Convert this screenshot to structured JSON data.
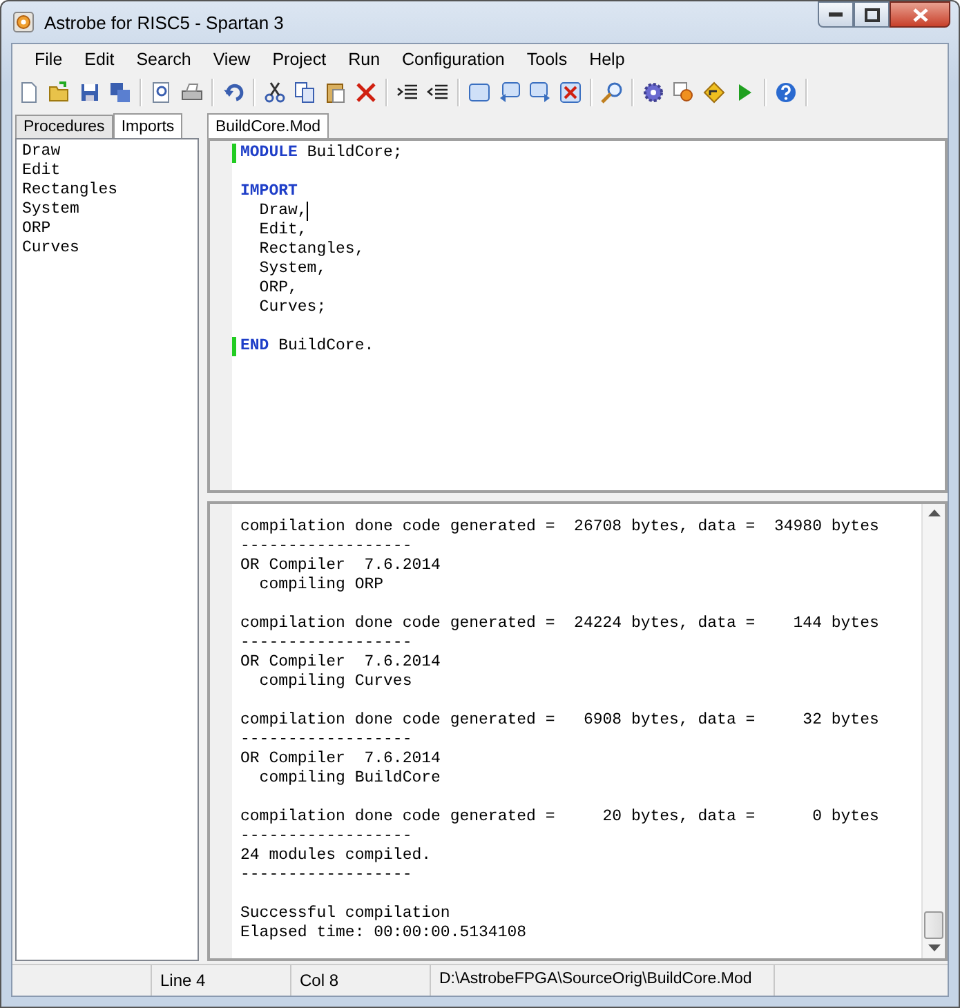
{
  "window": {
    "title": "Astrobe for RISC5  - Spartan 3"
  },
  "menu": [
    "File",
    "Edit",
    "Search",
    "View",
    "Project",
    "Run",
    "Configuration",
    "Tools",
    "Help"
  ],
  "side_tabs": [
    {
      "label": "Procedures",
      "selected": false
    },
    {
      "label": "Imports",
      "selected": true
    }
  ],
  "side_items": [
    "Draw",
    "Edit",
    "Rectangles",
    "System",
    "ORP",
    "Curves"
  ],
  "editor_tabs": [
    {
      "label": "BuildCore.Mod",
      "selected": true
    }
  ],
  "code": [
    {
      "segments": [
        {
          "kind": "keyword",
          "text": "MODULE"
        },
        {
          "kind": "plain",
          "text": " BuildCore;"
        }
      ],
      "marked": true,
      "gap_before": false,
      "cursor": false
    },
    {
      "segments": [
        {
          "kind": "keyword",
          "text": "IMPORT"
        }
      ],
      "marked": false,
      "gap_before": true,
      "cursor": false
    },
    {
      "segments": [
        {
          "kind": "plain",
          "text": "  Draw,"
        }
      ],
      "marked": false,
      "gap_before": false,
      "cursor": true
    },
    {
      "segments": [
        {
          "kind": "plain",
          "text": "  Edit,"
        }
      ],
      "marked": false,
      "gap_before": false,
      "cursor": false
    },
    {
      "segments": [
        {
          "kind": "plain",
          "text": "  Rectangles,"
        }
      ],
      "marked": false,
      "gap_before": false,
      "cursor": false
    },
    {
      "segments": [
        {
          "kind": "plain",
          "text": "  System,"
        }
      ],
      "marked": false,
      "gap_before": false,
      "cursor": false
    },
    {
      "segments": [
        {
          "kind": "plain",
          "text": "  ORP,"
        }
      ],
      "marked": false,
      "gap_before": false,
      "cursor": false
    },
    {
      "segments": [
        {
          "kind": "plain",
          "text": "  Curves;"
        }
      ],
      "marked": false,
      "gap_before": false,
      "cursor": false
    },
    {
      "segments": [
        {
          "kind": "keyword",
          "text": "END"
        },
        {
          "kind": "plain",
          "text": " BuildCore."
        }
      ],
      "marked": true,
      "gap_before": true,
      "cursor": false
    }
  ],
  "output": [
    [
      "compilation done code generated =  26708 bytes, data =  34980 bytes",
      "------------------",
      "OR Compiler  7.6.2014",
      "  compiling ORP"
    ],
    [
      "compilation done code generated =  24224 bytes, data =    144 bytes",
      "------------------",
      "OR Compiler  7.6.2014",
      "  compiling Curves"
    ],
    [
      "compilation done code generated =   6908 bytes, data =     32 bytes",
      "------------------",
      "OR Compiler  7.6.2014",
      "  compiling BuildCore"
    ],
    [
      "compilation done code generated =     20 bytes, data =      0 bytes",
      "------------------",
      "24 modules compiled.",
      "------------------"
    ],
    [
      "Successful compilation",
      "Elapsed time: 00:00:00.5134108"
    ]
  ],
  "status_bar": [
    "Line 4",
    "Col 8",
    "D:\\AstrobeFPGA\\SourceOrig\\BuildCore.Mod"
  ]
}
